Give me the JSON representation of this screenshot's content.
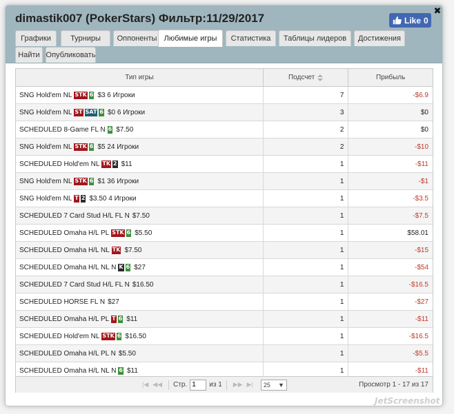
{
  "dialog": {
    "title": "dimastik007 (PokerStars) Фильтр:11/29/2017",
    "like_label": "Like",
    "like_count": "0",
    "close_glyph": "✖"
  },
  "tabs": [
    {
      "label": "Графики",
      "active": false
    },
    {
      "label": "Турниры",
      "active": false
    },
    {
      "label": "Оппоненты",
      "active": false
    },
    {
      "label": "Любимые игры",
      "active": true
    },
    {
      "label": "Статистика",
      "active": false
    },
    {
      "label": "Таблицы лидеров",
      "active": false
    },
    {
      "label": "Достижения",
      "active": false
    },
    {
      "label": "Найти",
      "active": false
    },
    {
      "label": "Опубликовать",
      "active": false
    }
  ],
  "grid": {
    "columns": {
      "type": "Тип игры",
      "count": "Подсчет",
      "profit": "Прибыль"
    },
    "rows": [
      {
        "game": "SNG Hold'em NL",
        "badges": [
          [
            "STK",
            "red"
          ],
          [
            "6",
            "green"
          ]
        ],
        "desc": "$3 6 Игроки",
        "count": "7",
        "profit": "-$6.9",
        "neg": true
      },
      {
        "game": "SNG Hold'em NL",
        "badges": [
          [
            "ST",
            "red"
          ],
          [
            "SAT",
            "teal"
          ],
          [
            "6",
            "green"
          ]
        ],
        "desc": "$0 6 Игроки",
        "count": "3",
        "profit": "$0",
        "neg": false
      },
      {
        "game": "SCHEDULED 8-Game FL N",
        "badges": [
          [
            "6",
            "green"
          ]
        ],
        "desc": "$7.50",
        "count": "2",
        "profit": "$0",
        "neg": false
      },
      {
        "game": "SNG Hold'em NL",
        "badges": [
          [
            "STK",
            "red"
          ],
          [
            "6",
            "green"
          ]
        ],
        "desc": "$5 24 Игроки",
        "count": "2",
        "profit": "-$10",
        "neg": true
      },
      {
        "game": "SCHEDULED Hold'em NL",
        "badges": [
          [
            "TK",
            "red"
          ],
          [
            "2",
            "dark"
          ]
        ],
        "desc": "$11",
        "count": "1",
        "profit": "-$11",
        "neg": true
      },
      {
        "game": "SNG Hold'em NL",
        "badges": [
          [
            "STK",
            "red"
          ],
          [
            "6",
            "green"
          ]
        ],
        "desc": "$1 36 Игроки",
        "count": "1",
        "profit": "-$1",
        "neg": true
      },
      {
        "game": "SNG Hold'em NL",
        "badges": [
          [
            "T",
            "red"
          ],
          [
            "2",
            "dark"
          ]
        ],
        "desc": "$3.50 4 Игроки",
        "count": "1",
        "profit": "-$3.5",
        "neg": true
      },
      {
        "game": "SCHEDULED 7 Card Stud H/L FL N",
        "badges": [],
        "desc": "$7.50",
        "count": "1",
        "profit": "-$7.5",
        "neg": true
      },
      {
        "game": "SCHEDULED Omaha H/L PL",
        "badges": [
          [
            "STK",
            "red"
          ],
          [
            "6",
            "green"
          ]
        ],
        "desc": "$5.50",
        "count": "1",
        "profit": "$58.01",
        "neg": false
      },
      {
        "game": "SCHEDULED Omaha H/L NL",
        "badges": [
          [
            "TK",
            "red"
          ]
        ],
        "desc": "$7.50",
        "count": "1",
        "profit": "-$15",
        "neg": true
      },
      {
        "game": "SCHEDULED Omaha H/L NL N",
        "badges": [
          [
            "K",
            "dark"
          ],
          [
            "6",
            "green"
          ]
        ],
        "desc": "$27",
        "count": "1",
        "profit": "-$54",
        "neg": true
      },
      {
        "game": "SCHEDULED 7 Card Stud H/L FL N",
        "badges": [],
        "desc": "$16.50",
        "count": "1",
        "profit": "-$16.5",
        "neg": true
      },
      {
        "game": "SCHEDULED HORSE FL N",
        "badges": [],
        "desc": "$27",
        "count": "1",
        "profit": "-$27",
        "neg": true
      },
      {
        "game": "SCHEDULED Omaha H/L PL",
        "badges": [
          [
            "T",
            "red"
          ],
          [
            "6",
            "green"
          ]
        ],
        "desc": "$11",
        "count": "1",
        "profit": "-$11",
        "neg": true
      },
      {
        "game": "SCHEDULED Hold'em NL",
        "badges": [
          [
            "STK",
            "red"
          ],
          [
            "6",
            "green"
          ]
        ],
        "desc": "$16.50",
        "count": "1",
        "profit": "-$16.5",
        "neg": true
      },
      {
        "game": "SCHEDULED Omaha H/L PL N",
        "badges": [],
        "desc": "$5.50",
        "count": "1",
        "profit": "-$5.5",
        "neg": true
      },
      {
        "game": "SCHEDULED Omaha H/L NL N",
        "badges": [
          [
            "6",
            "green"
          ]
        ],
        "desc": "$11",
        "count": "1",
        "profit": "-$11",
        "neg": true
      }
    ]
  },
  "pager": {
    "first": "|◀",
    "prev": "◀◀",
    "page_label": "Стр.",
    "page_value": "1",
    "of_label": "из 1",
    "next": "▶▶",
    "last": "▶|",
    "page_size": "25",
    "view_text": "Просмотр 1 - 17 из 17"
  },
  "watermark": "JetScreenshot",
  "icons": {
    "like": "thumbs-up-icon",
    "close": "close-icon",
    "sort": "sort-arrows-icon",
    "select": "chevron-down-icon"
  }
}
